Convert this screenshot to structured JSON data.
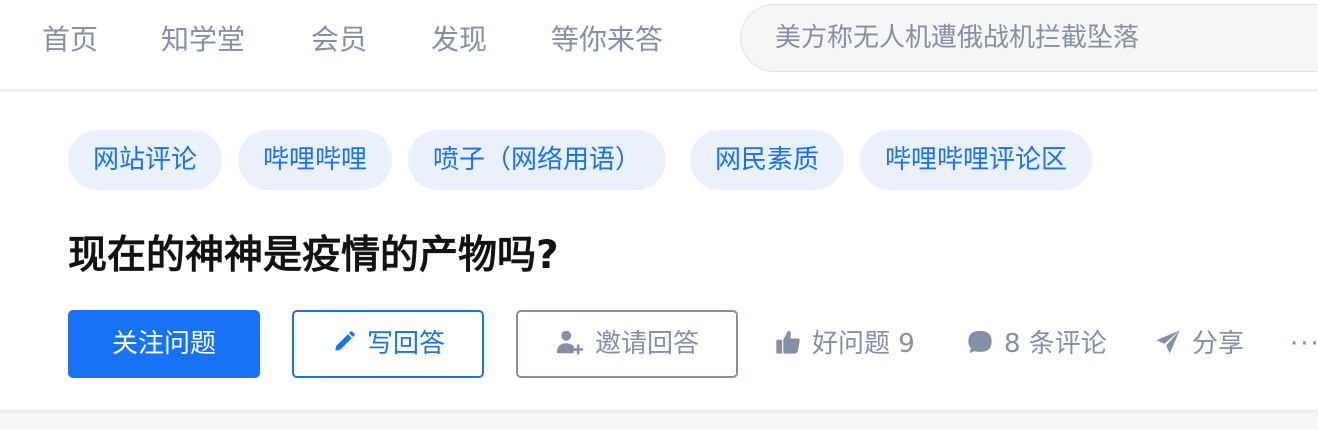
{
  "nav": {
    "items": [
      {
        "label": "首页"
      },
      {
        "label": "知学堂"
      },
      {
        "label": "会员"
      },
      {
        "label": "发现"
      },
      {
        "label": "等你来答"
      }
    ],
    "search_placeholder": "美方称无人机遭俄战机拦截坠落"
  },
  "question": {
    "tags": [
      {
        "label": "网站评论"
      },
      {
        "label": "哔哩哔哩"
      },
      {
        "label": "喷子（网络用语）"
      },
      {
        "label": "网民素质"
      },
      {
        "label": "哔哩哔哩评论区"
      }
    ],
    "title": "现在的神神是疫情的产物吗?",
    "follow_label": "关注问题",
    "write_label": "写回答",
    "invite_label": "邀请回答",
    "good_question_label": "好问题 9",
    "comments_label": "8 条评论",
    "share_label": "分享",
    "more_label": "···"
  },
  "colors": {
    "brand": "#1772f6",
    "tag_bg": "#ebf0fd",
    "muted": "#8590a6",
    "title": "#121212"
  },
  "icons": [
    "pencil-icon",
    "invite-person-icon",
    "thumbs-up-icon",
    "comment-bubble-icon",
    "paper-plane-icon",
    "more-dots-icon"
  ]
}
